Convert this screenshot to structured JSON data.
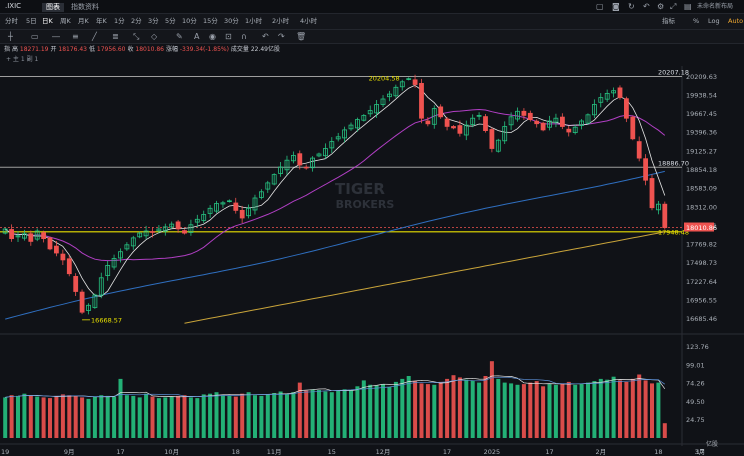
{
  "window": {
    "symbol": ".IXIC",
    "tabs": [
      "图表",
      "指数资料"
    ],
    "right_link": "未命名新布局",
    "scale_options": [
      "%",
      "Log",
      "Auto"
    ],
    "indicator_label": "指标"
  },
  "timeframes": [
    "分时",
    "5日",
    "日K",
    "周K",
    "月K",
    "年K",
    "1分",
    "2分",
    "3分",
    "5分",
    "10分",
    "15分",
    "30分",
    "1小时",
    "2小时",
    "4小时"
  ],
  "active_timeframe": "日K",
  "info": {
    "prefix": "指",
    "high_label": "高",
    "high": "18271.19",
    "open_label": "开",
    "open": "18176.43",
    "low_label": "低",
    "low": "17956.60",
    "close_label": "收",
    "close": "18010.86",
    "change_label": "涨幅",
    "change": "-339.34(-1.85%)",
    "turnover_label": "成交量",
    "turnover": "22.49亿股"
  },
  "subinfo": "+ 主 1 副 1",
  "colors": {
    "up": "#26c281",
    "down": "#ef5350",
    "ma_white": "#e6e6e6",
    "ma_purple": "#b13fc4",
    "ma_blue": "#2f6fc0",
    "ma_gold": "#c9a43a",
    "hline": "#9e9e9e",
    "yellow": "#e8e000"
  },
  "watermark": {
    "line1": "TIGER",
    "line2": "BROKERS"
  },
  "chart_data": {
    "type": "candlestick",
    "ylim": [
      16550,
      20330
    ],
    "price_ticks": [
      "20209.63",
      "19938.54",
      "19667.45",
      "19396.36",
      "19125.27",
      "18854.18",
      "18583.09",
      "18312.00",
      "18040.91",
      "17769.82",
      "17498.73",
      "17227.64",
      "16956.55",
      "16685.46"
    ],
    "volume_ticks": [
      "123.76",
      "99.01",
      "74.26",
      "49.50",
      "24.75"
    ],
    "volume_unit": "亿股",
    "x_ticks": [
      {
        "label": "19",
        "i": 0
      },
      {
        "label": "9月",
        "i": 10
      },
      {
        "label": "17",
        "i": 18
      },
      {
        "label": "10月",
        "i": 26
      },
      {
        "label": "18",
        "i": 36
      },
      {
        "label": "11月",
        "i": 42
      },
      {
        "label": "15",
        "i": 51
      },
      {
        "label": "12月",
        "i": 59
      },
      {
        "label": "17",
        "i": 69
      },
      {
        "label": "2025",
        "i": 76
      },
      {
        "label": "17",
        "i": 85
      },
      {
        "label": "2月",
        "i": 93
      },
      {
        "label": "18",
        "i": 102
      },
      {
        "label": "3月",
        "i": 109
      },
      {
        "label": "17",
        "i": 118
      }
    ],
    "annotations": {
      "high_label": "20204.58",
      "high_value": 20204.58,
      "low_label": "16668.57",
      "low_value": 16668.57,
      "hline_top": "20207.18",
      "hline_top_value": 20207.18,
      "hline_mid": "18886.70",
      "hline_mid_value": 18886.7,
      "hline_low": "17948.48",
      "hline_low_value": 17948.48,
      "last_price": "18010.86",
      "last_value": 18010.86
    },
    "closes": [
      17990,
      17850,
      17890,
      17920,
      17810,
      17960,
      17850,
      17700,
      17640,
      17540,
      17340,
      17080,
      16780,
      16880,
      17030,
      17280,
      17460,
      17560,
      17660,
      17760,
      17860,
      17930,
      17960,
      17940,
      17990,
      18020,
      18060,
      17990,
      17930,
      18050,
      18130,
      18200,
      18290,
      18360,
      18370,
      18400,
      18260,
      18150,
      18290,
      18440,
      18530,
      18660,
      18780,
      18890,
      18990,
      19060,
      18920,
      18880,
      19020,
      19080,
      19160,
      19260,
      19330,
      19430,
      19500,
      19580,
      19640,
      19710,
      19800,
      19880,
      19950,
      20050,
      20130,
      20174,
      20090,
      19600,
      19520,
      19740,
      19620,
      19480,
      19460,
      19380,
      19500,
      19600,
      19640,
      19420,
      19160,
      19280,
      19480,
      19620,
      19700,
      19640,
      19580,
      19520,
      19430,
      19560,
      19600,
      19480,
      19400,
      19470,
      19560,
      19650,
      19800,
      19900,
      19960,
      20000,
      19900,
      19600,
      19300,
      19020,
      18700,
      18300,
      18350,
      18010
    ]
  },
  "volume_values": [
    55,
    58,
    57,
    60,
    58,
    56,
    55,
    54,
    57,
    59,
    58,
    57,
    55,
    53,
    56,
    58,
    57,
    56,
    80,
    58,
    57,
    55,
    60,
    56,
    54,
    55,
    56,
    57,
    58,
    55,
    54,
    59,
    60,
    62,
    58,
    57,
    56,
    60,
    62,
    58,
    57,
    59,
    61,
    63,
    60,
    62,
    75,
    64,
    66,
    65,
    63,
    62,
    64,
    66,
    65,
    70,
    78,
    72,
    71,
    73,
    69,
    76,
    80,
    84,
    77,
    74,
    73,
    72,
    76,
    80,
    85,
    82,
    79,
    78,
    75,
    84,
    104,
    80,
    75,
    74,
    72,
    73,
    75,
    77,
    70,
    73,
    72,
    74,
    76,
    72,
    73,
    75,
    77,
    80,
    79,
    83,
    78,
    76,
    80,
    86,
    78,
    74,
    75,
    20
  ]
}
